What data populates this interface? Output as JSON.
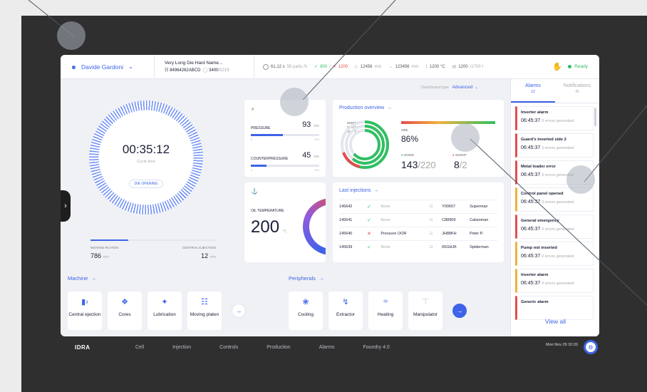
{
  "topbar": {
    "user_name": "Davide Gardoni",
    "mold_name": "Very Long Die Hard Name...",
    "mold_id": "84964262ABCD",
    "mold_count": "3400",
    "mold_total": "/5219",
    "cycle_count": "61,12 s",
    "parts_rate": "58 parts /h",
    "good_count": "800",
    "scrap_count": "1200",
    "stroke": "12456",
    "stroke_unit": "mm",
    "length": "123456",
    "length_unit": "mm",
    "temp": "1200 °C",
    "power": "1200",
    "power_total": "/1700 t",
    "status": "Ready"
  },
  "dashboard": {
    "type_label": "Dashboard type",
    "type_value": "Advanced"
  },
  "cycle": {
    "time": "00:35:12",
    "label": "Cycle time",
    "state": "DIE OPENING"
  },
  "platen": {
    "moving_label": "MOVING PLATEN",
    "moving_value": "786",
    "moving_unit": "mm",
    "ejection_label": "CENTRAL EJECTION",
    "ejection_value": "12",
    "ejection_unit": "mm",
    "progress": 0.3
  },
  "pressure": {
    "label": "PRESSURE",
    "value": "93",
    "unit": "bar",
    "min": "0",
    "max": "200",
    "level": 0.47,
    "counter_label": "COUNTERPRESSURE",
    "counter_value": "45",
    "counter_unit": "bar",
    "counter_min": "0",
    "counter_max": "200",
    "counter_level": 0.23
  },
  "oil": {
    "label": "OIL TEMPERATURE",
    "value": "200",
    "unit": "°C"
  },
  "production": {
    "title": "Production overview",
    "shift_a": "SHIFT A",
    "shift_b": "SHIFT B",
    "shift_c": "SHIFT C",
    "oee_label": "OEE",
    "oee_value": "86%",
    "good_label": "GOOD",
    "good_value": "143",
    "good_total": "/220",
    "scrap_label": "SCRAP",
    "scrap_value": "8",
    "scrap_total": "/2"
  },
  "injections": {
    "title": "Last injections",
    "rows": [
      {
        "id": "145642",
        "status": "ok",
        "note": "None",
        "code": "Y00657",
        "operator": "Superman"
      },
      {
        "id": "145641",
        "status": "ok",
        "note": "None",
        "code": "C88909",
        "operator": "Catwoman"
      },
      {
        "id": "145640",
        "status": "err",
        "note": "Pressure OOR",
        "code": "JH88KH",
        "operator": "Peter P."
      },
      {
        "id": "145639",
        "status": "ok",
        "note": "None",
        "code": "65GHJK",
        "operator": "Spiderman"
      }
    ]
  },
  "machine": {
    "title": "Machine",
    "tiles": [
      "Central ejection",
      "Cores",
      "Lubrication",
      "Moving platen"
    ]
  },
  "peripherals": {
    "title": "Peripherals",
    "tiles": [
      "Cooling",
      "Extractor",
      "Heating",
      "Manipulator"
    ]
  },
  "alarms": {
    "tab_alarms": "Alarms",
    "tab_alarms_count": "12",
    "tab_notifications": "Notifications",
    "tab_notifications_count": "45",
    "items": [
      {
        "title": "Inverter alarm",
        "time": "06:45:37",
        "note": "0 errors generated",
        "severity": "error"
      },
      {
        "title": "Guard's inverted side 2",
        "time": "06:45:37",
        "note": "0 errors generated",
        "severity": "error"
      },
      {
        "title": "Metal loader error",
        "time": "06:45:37",
        "note": "0 errors generated",
        "severity": "error"
      },
      {
        "title": "Control panel opened",
        "time": "06:45:37",
        "note": "0 errors generated",
        "severity": "warn"
      },
      {
        "title": "General emergency",
        "time": "06:45:37",
        "note": "0 errors generated",
        "severity": "error"
      },
      {
        "title": "Pump not inserted",
        "time": "06:45:37",
        "note": "0 errors generated",
        "severity": "warn"
      },
      {
        "title": "Inverter alarm",
        "time": "06:45:37",
        "note": "0 errors generated",
        "severity": "warn"
      },
      {
        "title": "Generic alarm",
        "time": "",
        "note": "",
        "severity": "error"
      }
    ],
    "view_all": "View all"
  },
  "nav": {
    "logo": "IDRA",
    "items": [
      "Cell",
      "Injection",
      "Controls",
      "Production",
      "Alarms",
      "Foundry 4.0"
    ],
    "datetime": "Mon Nov 29  10:20"
  },
  "colors": {
    "accent": "#3d63e8",
    "good": "#2fbf62",
    "error": "#e44d4d",
    "warning": "#f0b23c"
  }
}
